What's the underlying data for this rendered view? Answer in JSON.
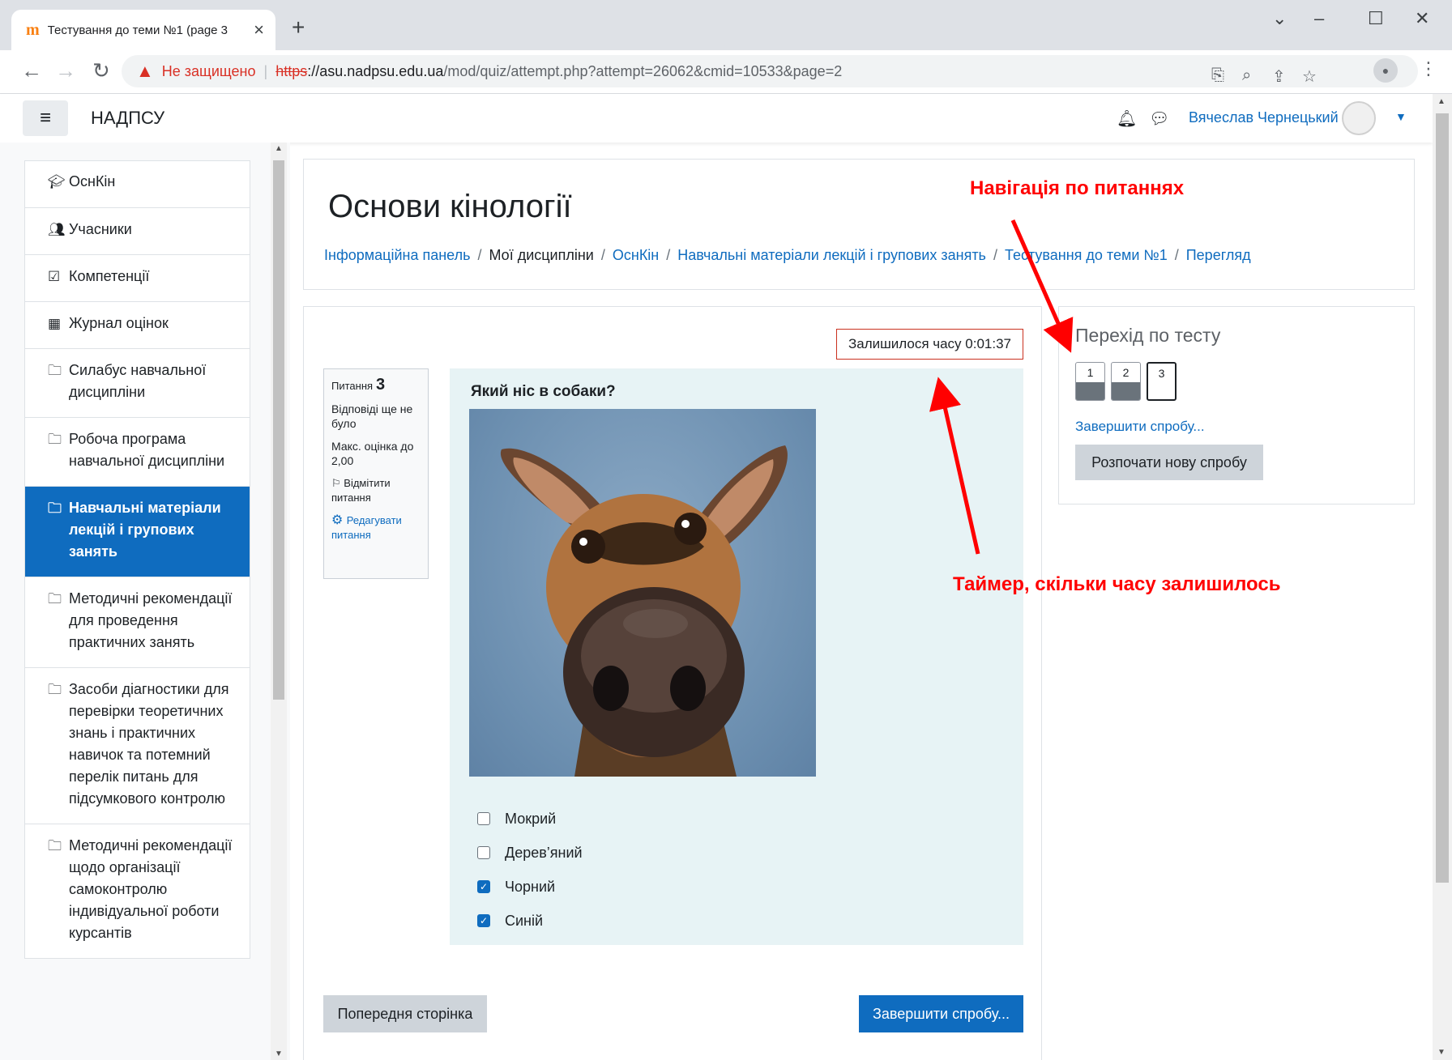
{
  "browser": {
    "tab_title": "Тестування до теми №1 (page 3",
    "url_warning": "Не защищено",
    "url_scheme": "https",
    "url_host": "://asu.nadpsu.edu.ua",
    "url_path": "/mod/quiz/attempt.php?attempt=26062&cmid=10533&page=2"
  },
  "navbar": {
    "site_name": "НАДПСУ",
    "user_name": "Вячеслав Чернецький"
  },
  "sidebar": {
    "items": [
      {
        "label": "ОснКін",
        "icon": "graduation-cap-icon",
        "active": false
      },
      {
        "label": "Учасники",
        "icon": "users-icon",
        "active": false
      },
      {
        "label": "Компетенції",
        "icon": "checkbox-icon",
        "active": false
      },
      {
        "label": "Журнал оцінок",
        "icon": "table-icon",
        "active": false
      },
      {
        "label": "Силабус навчальної дисципліни",
        "icon": "folder-icon",
        "active": false
      },
      {
        "label": "Робоча програма навчальної дисципліни",
        "icon": "folder-icon",
        "active": false
      },
      {
        "label": "Навчальні матеріали лекцій і групових занять",
        "icon": "folder-icon",
        "active": true
      },
      {
        "label": "Методичні рекомендації для проведення практичних занять",
        "icon": "folder-icon",
        "active": false
      },
      {
        "label": "Засоби діагностики для перевірки теоретичних знань і практичних навичок та потемний перелік питань для підсумкового контролю",
        "icon": "folder-icon",
        "active": false
      },
      {
        "label": "Методичні рекомендації щодо організації самоконтролю індивідуальної роботи курсантів",
        "icon": "folder-icon",
        "active": false
      }
    ]
  },
  "header": {
    "course_title": "Основи кінології",
    "breadcrumb": [
      "Інформаційна панель",
      "Мої дисципліни",
      "ОснКін",
      "Навчальні матеріали лекцій і групових занять",
      "Тестування до теми №1",
      "Перегляд"
    ]
  },
  "quiz": {
    "timer": "Залишилося часу 0:01:37",
    "question_label": "Питання",
    "question_number": "3",
    "status": "Відповіді ще не було",
    "max_grade": "Макс. оцінка до 2,00",
    "flag_label": "Відмітити питання",
    "edit_label": "Редагувати питання",
    "question_text": "Який ніс в собаки?",
    "options": [
      {
        "label": "Мокрий",
        "checked": false
      },
      {
        "label": "Дерев’яний",
        "checked": false
      },
      {
        "label": "Чорний",
        "checked": true
      },
      {
        "label": "Синій",
        "checked": true
      }
    ],
    "prev_button": "Попередня сторінка",
    "finish_button": "Завершити спробу..."
  },
  "quiz_navigation": {
    "title": "Перехід по тесту",
    "questions": [
      {
        "number": "1",
        "answered": true,
        "current": false
      },
      {
        "number": "2",
        "answered": true,
        "current": false
      },
      {
        "number": "3",
        "answered": false,
        "current": true
      }
    ],
    "finish_link": "Завершити спробу...",
    "new_attempt_button": "Розпочати нову спробу"
  },
  "annotations": {
    "nav_label": "Навігація по питаннях",
    "timer_label": "Таймер, скільки часу залишилось",
    "color": "#ff0000"
  },
  "colors": {
    "primary": "#0f6cbf",
    "question_bg": "#e7f3f5",
    "timer_border": "#ca3120"
  }
}
